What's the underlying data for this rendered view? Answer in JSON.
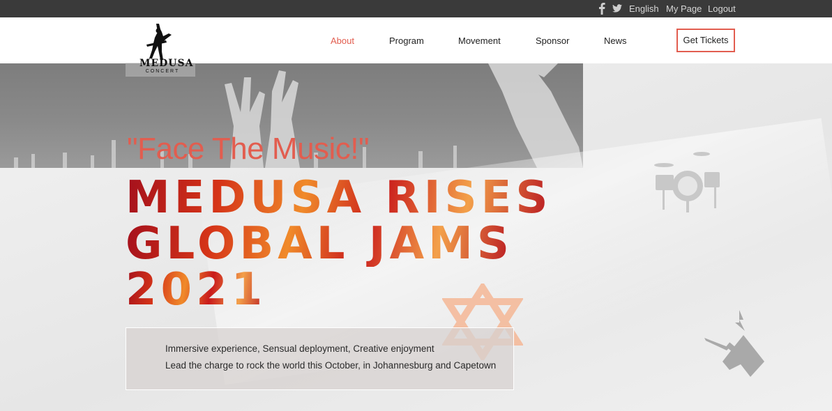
{
  "topbar": {
    "icons": [
      "facebook-icon",
      "twitter-icon"
    ],
    "language": "English",
    "my_page": "My Page",
    "logout": "Logout"
  },
  "brand": {
    "name": "MEDUSA",
    "sub": "CONCERT"
  },
  "nav": {
    "items": [
      "About",
      "Program",
      "Movement",
      "Sponsor",
      "News"
    ],
    "active": "About",
    "cta": "Get Tickets"
  },
  "hero": {
    "quote": "\"Face The Music!\"",
    "headline_lines": [
      "MEDUSA RISES",
      "GLOBAL JAMS",
      "2021"
    ],
    "info_lines": [
      "Immersive experience, Sensual deployment, Creative enjoyment",
      "Lead the charge to rock the world this October, in Johannesburg and Capetown"
    ]
  },
  "colors": {
    "accent": "#e25d4f",
    "topbar_bg": "#3a3a3a",
    "header_bg": "#ffffff"
  }
}
